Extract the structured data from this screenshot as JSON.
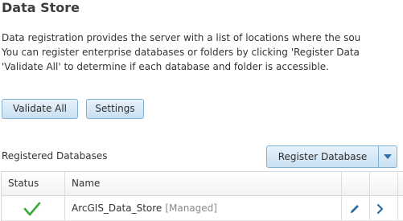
{
  "page": {
    "title": "Data Store",
    "description_lines": [
      "Data registration provides the server with a list of locations where the sou",
      "You can register enterprise databases or folders by clicking 'Register Data",
      "'Validate All' to determine if each database and folder is accessible."
    ]
  },
  "toolbar": {
    "validate_all_label": "Validate All",
    "settings_label": "Settings"
  },
  "registered": {
    "section_label": "Registered Databases",
    "register_button_label": "Register Database"
  },
  "table": {
    "columns": [
      "Status",
      "Name"
    ],
    "rows": [
      {
        "status": "valid",
        "status_icon": "checkmark-icon",
        "name": "ArcGIS_Data_Store",
        "tag": "[Managed]"
      }
    ]
  },
  "colors": {
    "accent": "#2e6da4",
    "check": "#3aa83a",
    "button_border": "#7eb2d6"
  }
}
